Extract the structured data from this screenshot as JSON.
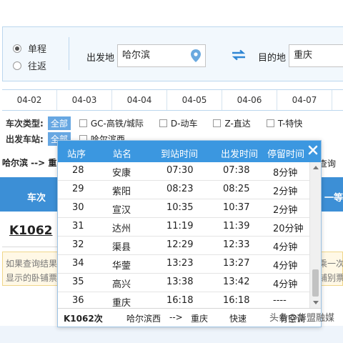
{
  "query": {
    "trip_options": [
      {
        "label": "单程",
        "selected": true
      },
      {
        "label": "往返",
        "selected": false
      }
    ],
    "from_label": "出发地",
    "from_value": "哈尔滨",
    "to_label": "目的地",
    "to_value": "重庆"
  },
  "dates": [
    "04-02",
    "04-03",
    "04-04",
    "04-05",
    "04-06",
    "04-07"
  ],
  "filters": {
    "type_label": "车次类型:",
    "type_all": "全部",
    "type_options": [
      "GC-高铁/城际",
      "D-动车",
      "Z-直达",
      "T-特快"
    ],
    "station_label": "出发车站:",
    "station_all": "全部",
    "station_options": [
      "哈尔滨西"
    ]
  },
  "results": {
    "route_text": "哈尔滨 --> 重",
    "route_right": "查询",
    "col_train": "车次",
    "col_first": "一等",
    "train_no": "K1062",
    "notice_line1_left": "如果查询结果",
    "notice_line2_left": "显示的卧铺票",
    "notice_line1_right": "乘一次",
    "notice_line2_right": "铺别票"
  },
  "popup": {
    "headers": [
      "站序",
      "站名",
      "到站时间",
      "出发时间",
      "停留时间"
    ],
    "rows": [
      {
        "seq": "28",
        "name": "安康",
        "arrive": "07:30",
        "depart": "07:38",
        "stay": "8分钟"
      },
      {
        "seq": "29",
        "name": "紫阳",
        "arrive": "08:23",
        "depart": "08:25",
        "stay": "2分钟"
      },
      {
        "seq": "30",
        "name": "宣汉",
        "arrive": "10:35",
        "depart": "10:37",
        "stay": "2分钟"
      },
      {
        "seq": "31",
        "name": "达州",
        "arrive": "11:19",
        "depart": "11:39",
        "stay": "20分钟"
      },
      {
        "seq": "32",
        "name": "渠县",
        "arrive": "12:29",
        "depart": "12:33",
        "stay": "4分钟"
      },
      {
        "seq": "34",
        "name": "华蓥",
        "arrive": "13:23",
        "depart": "13:27",
        "stay": "4分钟"
      },
      {
        "seq": "35",
        "name": "高兴",
        "arrive": "13:38",
        "depart": "13:42",
        "stay": "4分钟"
      },
      {
        "seq": "36",
        "name": "重庆",
        "arrive": "16:18",
        "depart": "16:18",
        "stay": "----"
      }
    ],
    "footer": {
      "train": "K1062次",
      "from": "哈尔滨西",
      "arrow": "-->",
      "to": "重庆",
      "type": "快速",
      "extra": "有空调"
    }
  },
  "watermark": "头条@华盟融媒",
  "colors": {
    "accent": "#3b97e0",
    "chip": "#67a7e2",
    "panel": "#f2f8fd"
  },
  "icons": [
    "location-pin-icon",
    "swap-icon",
    "close-icon"
  ]
}
